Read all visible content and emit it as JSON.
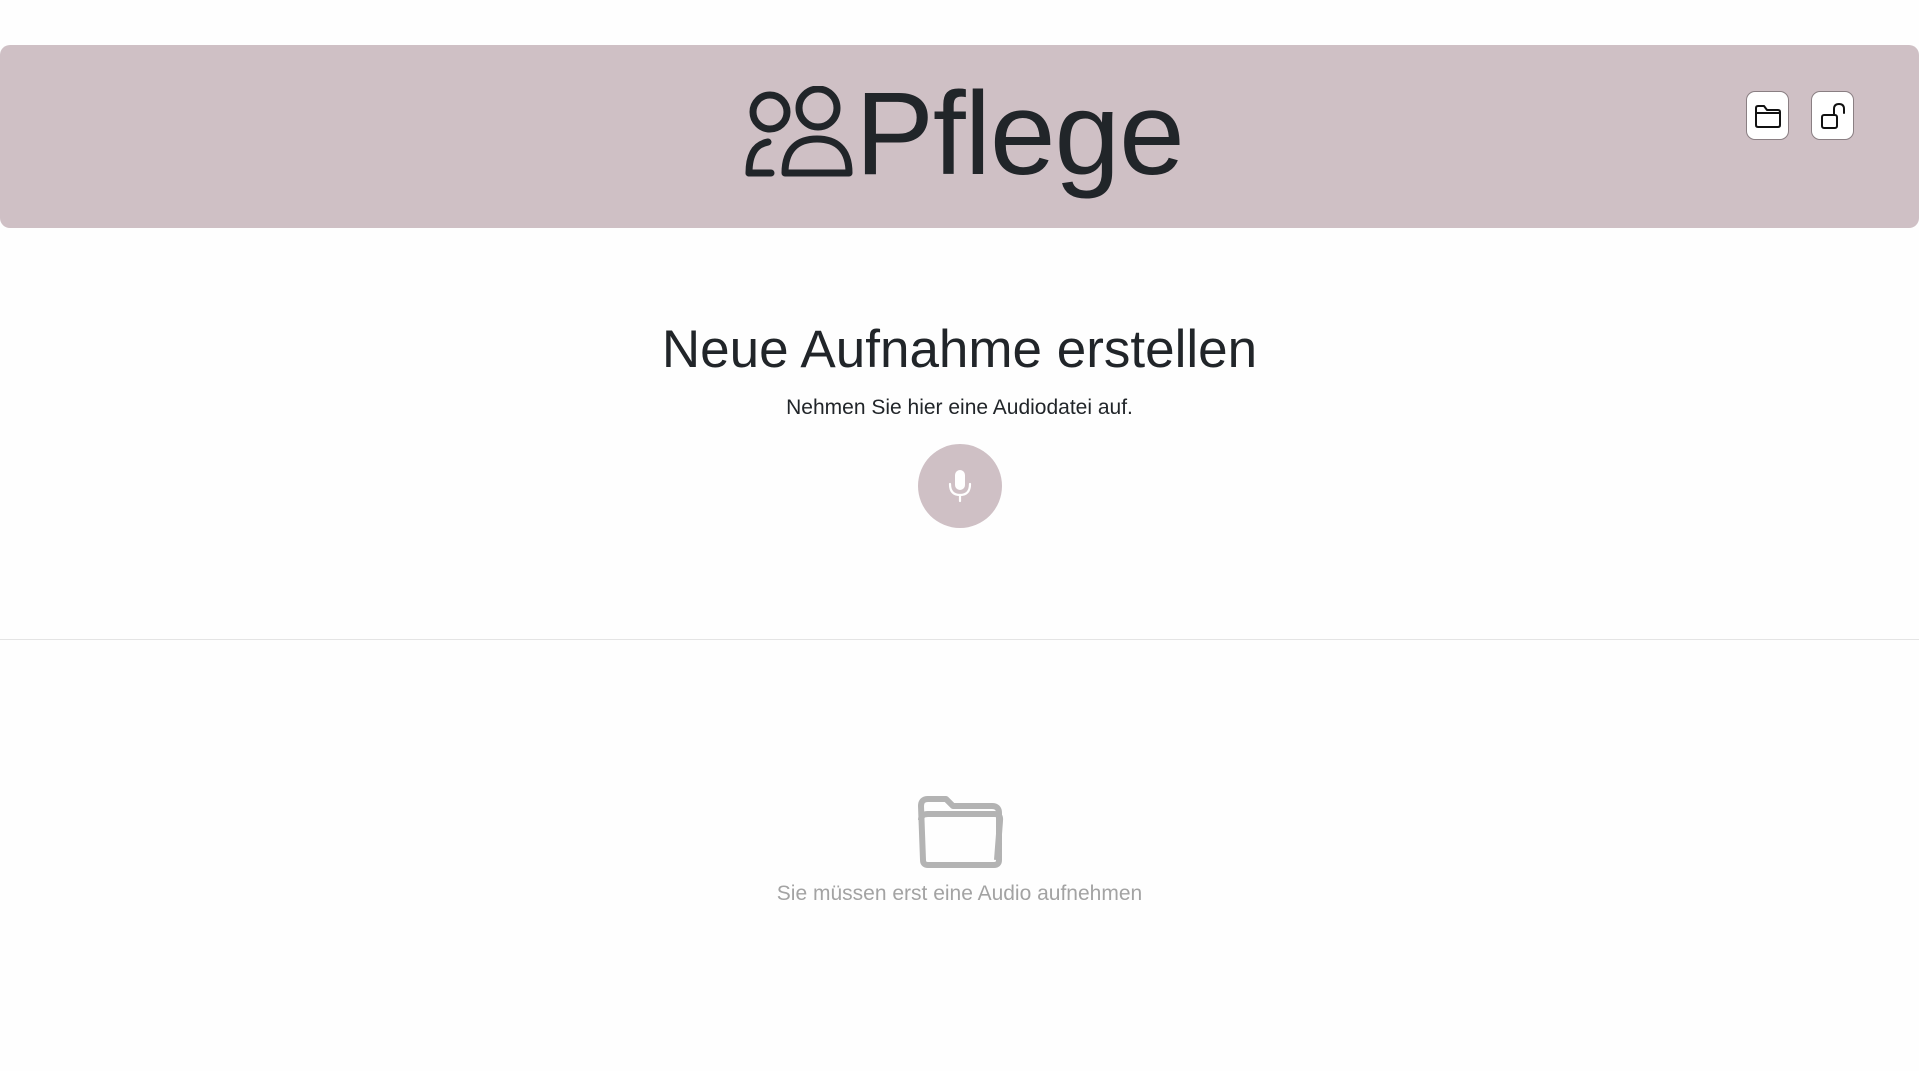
{
  "header": {
    "title": "Pflege",
    "logo_icon": "people-icon",
    "buttons": [
      {
        "icon": "folder-icon"
      },
      {
        "icon": "unlock-icon"
      }
    ]
  },
  "recording": {
    "title": "Neue Aufnahme erstellen",
    "subtitle": "Nehmen Sie hier eine Audiodatei auf.",
    "record_icon": "microphone-icon"
  },
  "empty_state": {
    "icon": "folder-icon",
    "message": "Sie müssen erst eine Audio aufnehmen"
  },
  "colors": {
    "header_bg": "#cfc0c5",
    "text": "#212529",
    "muted": "#a3a3a3"
  }
}
